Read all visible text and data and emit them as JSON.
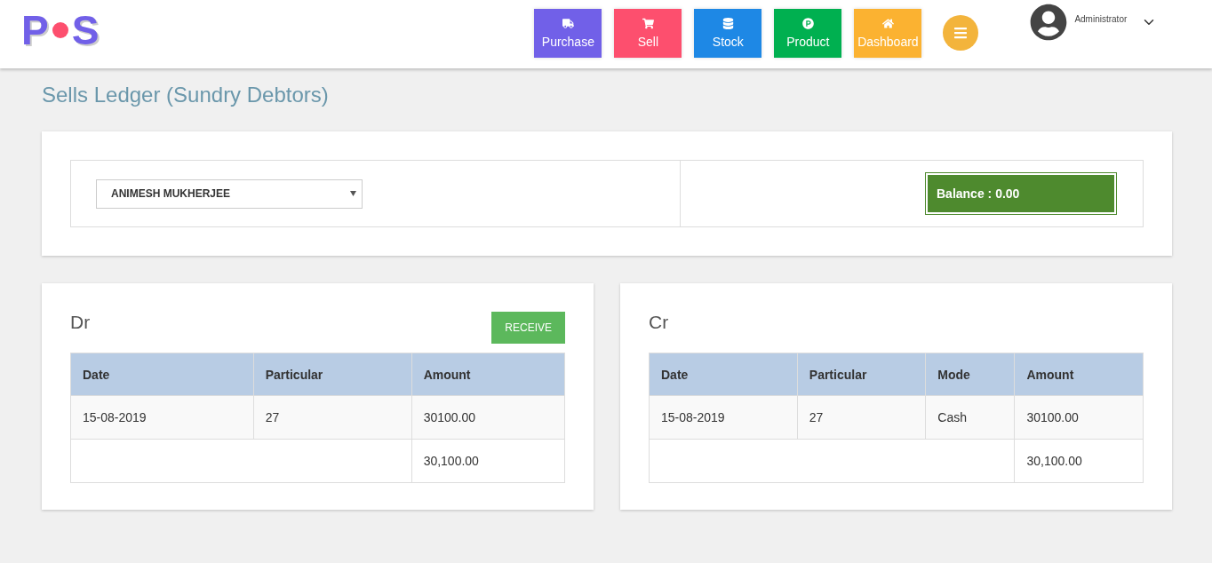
{
  "logo": {
    "letters": [
      "P",
      "S"
    ]
  },
  "nav_buttons": [
    {
      "kind": "truck",
      "label": "Purchase",
      "color": "#7160e8"
    },
    {
      "kind": "cart",
      "label": "Sell",
      "color": "#fd4f6e"
    },
    {
      "kind": "coins",
      "label": "Stock",
      "color": "#1e88e5"
    },
    {
      "kind": "product",
      "label": "Product",
      "color": "#00b050"
    },
    {
      "kind": "home",
      "label": "Dashboard",
      "color": "#fbb231"
    }
  ],
  "user": {
    "name": "Administrator"
  },
  "page_title": "Sells Ledger (Sundry Debtors)",
  "filter": {
    "customer": "ANIMESH MUKHERJEE",
    "balance": "Balance : 0.00"
  },
  "panels": [
    {
      "title": "Dr",
      "button": "RECEIVE",
      "columns": [
        "Date",
        "Particular",
        "Amount"
      ],
      "rows": [
        [
          "15-08-2019",
          "27",
          "30100.00"
        ]
      ],
      "total": "30,100.00"
    },
    {
      "title": "Cr",
      "columns": [
        "Date",
        "Particular",
        "Mode",
        "Amount"
      ],
      "rows": [
        [
          "15-08-2019",
          "27",
          "Cash",
          "30100.00"
        ]
      ],
      "total": "30,100.00"
    }
  ]
}
